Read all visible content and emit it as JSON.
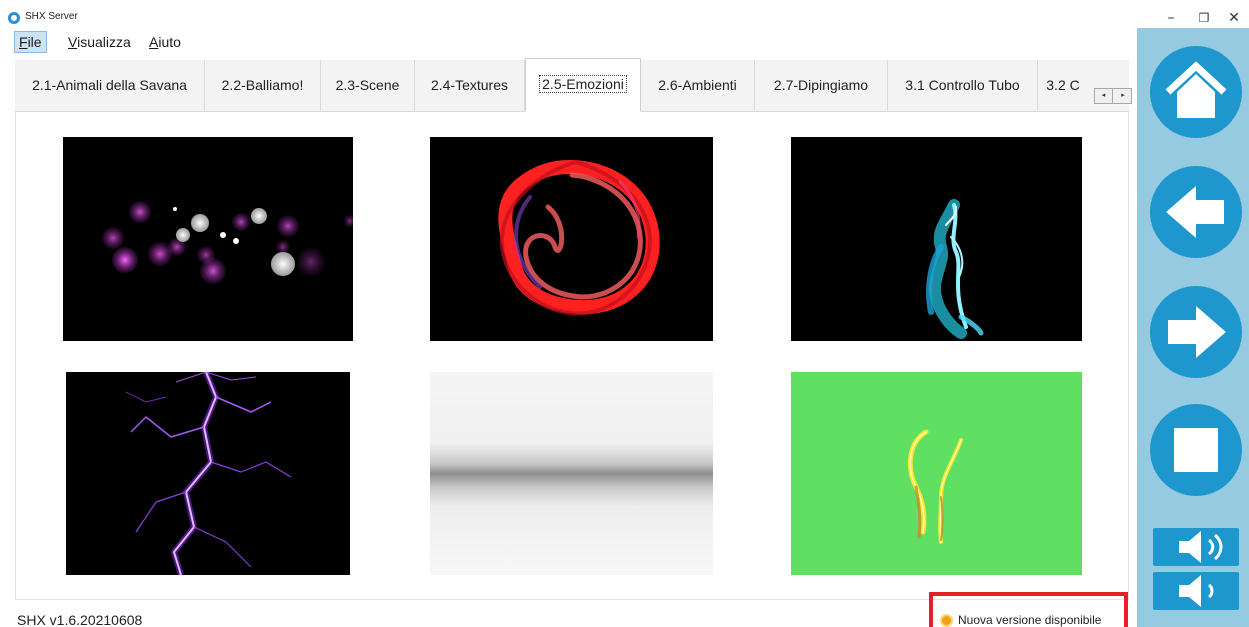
{
  "window": {
    "title": "SHX Server",
    "controls": {
      "minimize": "–",
      "maximize": "❐",
      "close": "✕"
    }
  },
  "menu": {
    "file": {
      "accel": "F",
      "rest": "ile"
    },
    "visualizza": {
      "accel": "V",
      "rest": "isualizza"
    },
    "aiuto": {
      "accel": "A",
      "rest": "iuto"
    }
  },
  "tabs": [
    {
      "label": "2.1-Animali della Savana",
      "active": false
    },
    {
      "label": "2.2-Balliamo!",
      "active": false
    },
    {
      "label": "2.3-Scene",
      "active": false
    },
    {
      "label": "2.4-Textures",
      "active": false
    },
    {
      "label": "2.5-Emozioni",
      "active": true
    },
    {
      "label": "2.6-Ambienti",
      "active": false
    },
    {
      "label": "2.7-Dipingiamo",
      "active": false
    },
    {
      "label": "3.1 Controllo Tubo",
      "active": false
    },
    {
      "label": "3.2 C",
      "active": false
    }
  ],
  "tab_scroller": {
    "left": "◂",
    "right": "▸"
  },
  "thumbnails": [
    {
      "icon": "pink-bubbles-thumbnail"
    },
    {
      "icon": "red-ring-thumbnail"
    },
    {
      "icon": "cyan-smoke-thumbnail"
    },
    {
      "icon": "purple-lightning-thumbnail"
    },
    {
      "icon": "grey-band-thumbnail"
    },
    {
      "icon": "yellow-strokes-thumbnail"
    }
  ],
  "status": {
    "version": "SHX v1.6.20210608",
    "update": "Nuova versione disponibile"
  },
  "controls": [
    {
      "icon": "home-icon"
    },
    {
      "icon": "arrow-left-icon"
    },
    {
      "icon": "arrow-right-icon"
    },
    {
      "icon": "stop-icon"
    },
    {
      "icon": "volume-up-icon"
    },
    {
      "icon": "volume-down-icon"
    }
  ],
  "colors": {
    "panel": "#96cae0",
    "control": "#1d97cd",
    "highlight": "#e52029",
    "tab_strip": "#f3f3f3"
  }
}
